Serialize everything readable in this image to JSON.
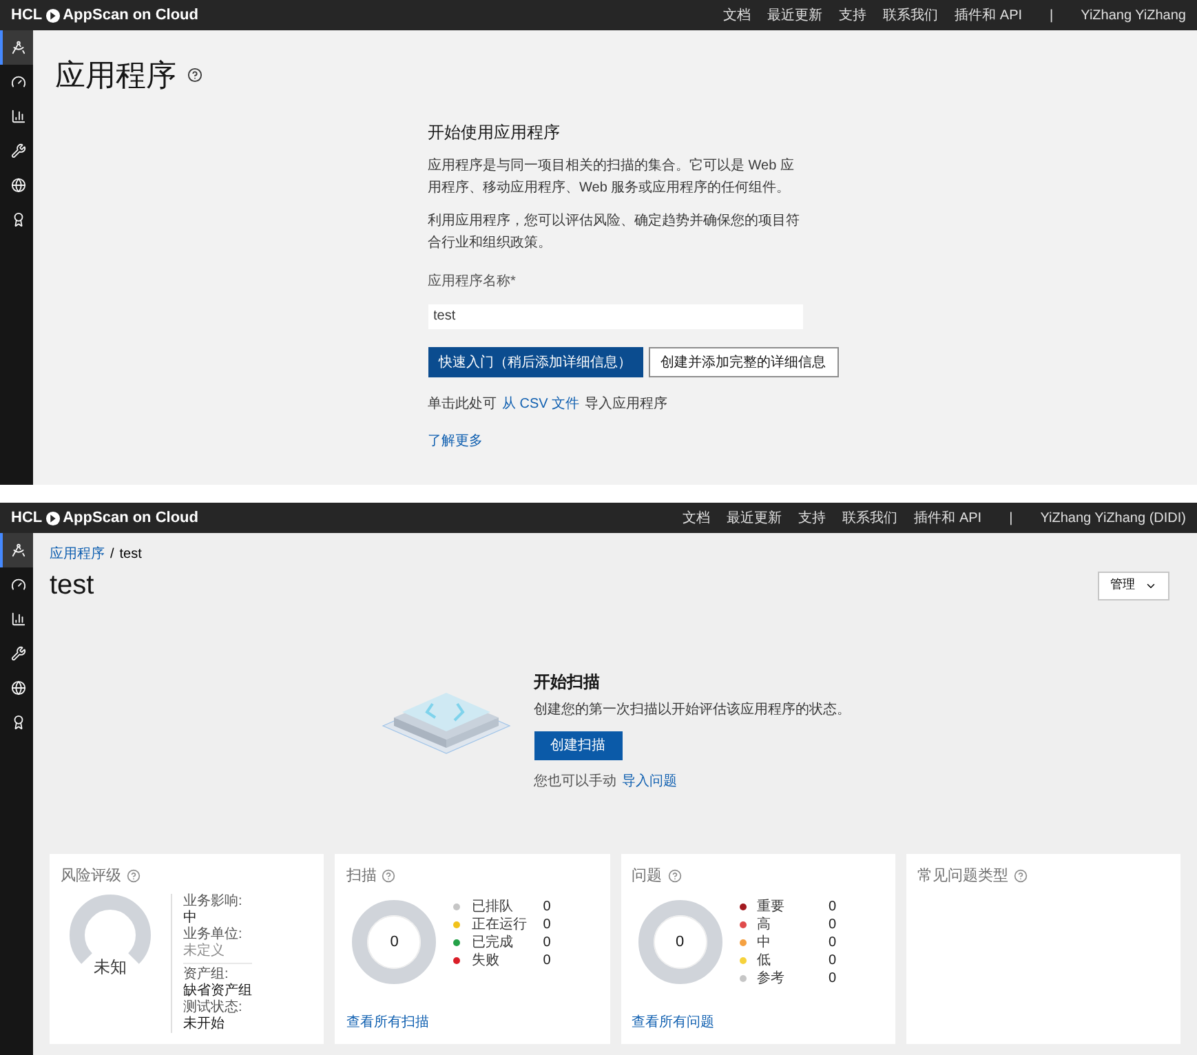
{
  "top_screen": {
    "header": {
      "brand_prefix": "HCL",
      "brand_name": "AppScan on Cloud",
      "nav_links": [
        "文档",
        "最近更新",
        "支持",
        "联系我们",
        "插件和 API"
      ],
      "separator": "|",
      "user": "YiZhang YiZhang"
    },
    "sidebar": {
      "items": [
        {
          "selected": true
        },
        {
          "selected": false
        },
        {
          "selected": false
        },
        {
          "selected": false
        },
        {
          "selected": false
        },
        {
          "selected": false
        }
      ]
    },
    "page_title": "应用程序",
    "getting_started": {
      "heading": "开始使用应用程序",
      "paragraphs": [
        "应用程序是与同一项目相关的扫描的集合。它可以是 Web 应用程序、移动应用程序、Web 服务或应用程序的任何组件。",
        "利用应用程序，您可以评估风险、确定趋势并确保您的项目符合行业和组织政策。"
      ],
      "field": {
        "label": "应用程序名称*",
        "value": "test"
      },
      "buttons": [
        {
          "label": "快速入门（稍后添加详细信息）",
          "kind": "primary"
        },
        {
          "label": "创建并添加完整的详细信息",
          "kind": "secondary"
        }
      ],
      "import_line": {
        "prefix": "单击此处可",
        "link": "从 CSV 文件",
        "suffix": "导入应用程序"
      },
      "learn_more": "了解更多"
    }
  },
  "bottom_screen": {
    "header": {
      "brand_prefix": "HCL",
      "brand_name": "AppScan on Cloud",
      "nav_links": [
        "文档",
        "最近更新",
        "支持",
        "联系我们",
        "插件和 API"
      ],
      "separator": "|",
      "user": "YiZhang YiZhang (DIDI)"
    },
    "sidebar": {
      "items": [
        {
          "selected": true
        },
        {
          "selected": false
        },
        {
          "selected": false
        },
        {
          "selected": false
        },
        {
          "selected": false
        },
        {
          "selected": false
        }
      ]
    },
    "breadcrumb": {
      "link": "应用程序",
      "separator": "/",
      "current": "test"
    },
    "page_title": "test",
    "manage_button": "管理",
    "start_scan": {
      "heading": "开始扫描",
      "description": "创建您的第一次扫描以开始评估该应用程序的状态。",
      "button": "创建扫描",
      "manual_line": {
        "prefix": "您也可以手动",
        "link": "导入问题"
      }
    },
    "risk_card": {
      "title": "风险评级",
      "gauge_label": "未知",
      "detail_groups": [
        {
          "items": [
            {
              "label": "业务影响:",
              "value": "中",
              "kind": "value"
            },
            {
              "label": "业务单位:",
              "value": "未定义",
              "kind": "unset"
            }
          ]
        },
        {
          "items": [
            {
              "label": "资产组:",
              "value": "缺省资产组",
              "kind": "value"
            },
            {
              "label": "测试状态:",
              "value": "未开始",
              "kind": "value"
            }
          ]
        }
      ]
    },
    "scans_card": {
      "title": "扫描",
      "total": "0",
      "legend": [
        {
          "label": "已排队",
          "count": "0",
          "color": "#c6c6c6"
        },
        {
          "label": "正在运行",
          "count": "0",
          "color": "#f1c21b"
        },
        {
          "label": "已完成",
          "count": "0",
          "color": "#24a148"
        },
        {
          "label": "失败",
          "count": "0",
          "color": "#da1e28"
        }
      ],
      "link": "查看所有扫描"
    },
    "issues_card": {
      "title": "问题",
      "total": "0",
      "legend": [
        {
          "label": "重要",
          "count": "0",
          "color": "#a2191f"
        },
        {
          "label": "高",
          "count": "0",
          "color": "#e04b4b"
        },
        {
          "label": "中",
          "count": "0",
          "color": "#f5a142"
        },
        {
          "label": "低",
          "count": "0",
          "color": "#f6d23c"
        },
        {
          "label": "参考",
          "count": "0",
          "color": "#c6c6c6"
        }
      ],
      "link": "查看所有问题"
    },
    "issue_types_card": {
      "title": "常见问题类型"
    }
  }
}
